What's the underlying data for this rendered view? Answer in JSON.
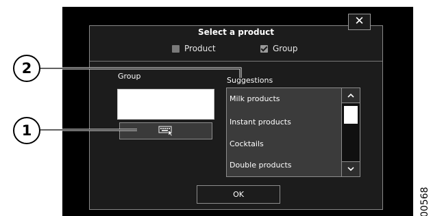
{
  "dialog": {
    "title": "Select a product",
    "close_label": "✕",
    "filters": [
      {
        "label": "Product",
        "checked": false
      },
      {
        "label": "Group",
        "checked": true
      }
    ],
    "group_label": "Group",
    "group_value": "",
    "suggestions_label": "Suggestions",
    "suggestions": [
      "Milk products",
      "Instant products",
      "Cocktails",
      "Double products"
    ],
    "scroll_up": "⌃",
    "scroll_down": "⌄",
    "ok_label": "OK",
    "keyboard_icon": "keyboard-icon"
  },
  "callouts": [
    "1",
    "2"
  ],
  "figure_id": "00568",
  "colors": {
    "dialog_bg": "#1c1c1c",
    "list_bg": "#3b3b3b",
    "border": "#8e8e8e"
  }
}
